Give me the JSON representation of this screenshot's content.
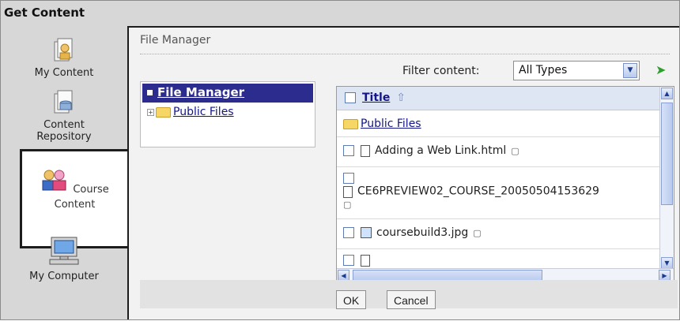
{
  "window": {
    "title": "Get Content"
  },
  "nav": {
    "items": [
      {
        "id": "my-content",
        "label": "My Content",
        "icon": "my-content-icon"
      },
      {
        "id": "content-repository",
        "label": "Content\nRepository",
        "icon": "content-repository-icon"
      },
      {
        "id": "course-content",
        "label": "Course\nContent",
        "icon": "course-content-icon",
        "active": true
      },
      {
        "id": "my-computer",
        "label": "My Computer",
        "icon": "my-computer-icon"
      }
    ]
  },
  "main": {
    "header": "File Manager",
    "filter": {
      "label": "Filter content:",
      "value": "All Types"
    },
    "tree": {
      "root": "File Manager",
      "children": [
        "Public Files"
      ]
    },
    "list": {
      "column_title": "Title",
      "rows": [
        {
          "name": "Public Files",
          "type": "folder"
        },
        {
          "name": "Adding a Web Link.html",
          "type": "document"
        },
        {
          "name": "CE6PREVIEW02_COURSE_200505041536​29",
          "type": "document"
        },
        {
          "name": "coursebuild3.jpg",
          "type": "image"
        }
      ]
    },
    "buttons": {
      "ok": "OK",
      "cancel": "Cancel"
    }
  }
}
